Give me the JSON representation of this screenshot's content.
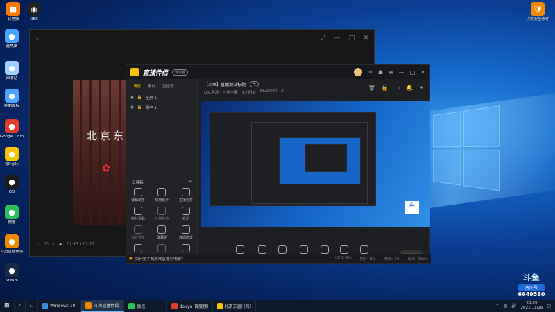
{
  "desktop_icons": [
    {
      "label": "此电脑",
      "icon": "computer-icon",
      "color": "#4aa3ff"
    },
    {
      "label": "回收站",
      "icon": "recycle-bin-icon",
      "color": "#9fd0ff"
    },
    {
      "label": "控制面板",
      "icon": "control-panel-icon",
      "color": "#4aa3ff"
    },
    {
      "label": "Google Chrome",
      "icon": "chrome-icon",
      "color": "#e33b2e"
    },
    {
      "label": "QQ音乐",
      "icon": "qqmusic-icon",
      "color": "#f5c400"
    },
    {
      "label": "QQ",
      "icon": "qq-icon",
      "color": "#1b1b1b"
    },
    {
      "label": "微信",
      "icon": "wechat-icon",
      "color": "#2cc05c"
    },
    {
      "label": "斗鱼直播伴侣",
      "icon": "douyu-icon",
      "color": "#f08a00"
    },
    {
      "label": "Steam",
      "icon": "steam-icon",
      "color": "#1b2a44"
    }
  ],
  "top_icons": [
    {
      "label": "此电脑",
      "color": "#ff7a00"
    },
    {
      "label": "OBS",
      "color": "#222"
    }
  ],
  "top_right_icon": {
    "label": "火绒安全软件",
    "color": "#f08a00"
  },
  "player": {
    "time": "02:13 / 02:17",
    "video_text": "北京东"
  },
  "app": {
    "title": "直播伴侣",
    "version_tag": "测试版",
    "left_tabs": [
      "场景",
      "素材",
      "直播源"
    ],
    "scenes": [
      "全屏 1",
      "画中 1"
    ],
    "tools_title": "工具箱",
    "tools": [
      {
        "label": "弹幕助手",
        "dim": false
      },
      {
        "label": "房管助手",
        "dim": false
      },
      {
        "label": "主播任务",
        "dim": false
      },
      {
        "label": "粉丝道具",
        "dim": false
      },
      {
        "label": "礼物特效",
        "dim": true
      },
      {
        "label": "音乐",
        "dim": false
      },
      {
        "label": "语音连麦",
        "dim": true
      },
      {
        "label": "弹幕姬",
        "dim": false
      },
      {
        "label": "数据统计",
        "dim": false
      },
      {
        "label": "全民PK",
        "dim": false
      },
      {
        "label": "互动游戏",
        "dim": true
      },
      {
        "label": "上传一键",
        "dim": false
      }
    ],
    "notice": "如何把手机游戏直播到电脑?",
    "notice_right": [
      "CPU: 4%",
      "内存: 8%",
      "帧率: 60",
      "码率: 0kb/s"
    ],
    "main_title": "【斗鱼】直播测试标题",
    "main_title_tag": "改",
    "main_sub": [
      "LOL手游 - 斗鱼主播",
      "1小时前",
      "6649580",
      "0"
    ],
    "bottom_tools": [
      "直播录屏",
      "摄像头",
      "多机位",
      "手机投屏",
      "游戏",
      "麦克风",
      "扬声器"
    ],
    "go_live": "开始直播"
  },
  "taskbar": {
    "apps": [
      {
        "label": "Windows 10 ...",
        "color": "#3a8de0",
        "active": false
      },
      {
        "label": "斗鱼直播伴侣",
        "color": "#f08a00",
        "active": true
      },
      {
        "label": "微信",
        "color": "#2cc05c",
        "active": false
      },
      {
        "label": "douyu_百度搜索",
        "color": "#e33b2e",
        "active": false
      },
      {
        "label": "北京东直门的日子",
        "color": "#f5c400",
        "active": false
      }
    ],
    "time": "20:09",
    "date": "2021/11/26"
  },
  "watermark": {
    "logo": "斗鱼",
    "room_label": "房间号",
    "room_number": "6649580"
  }
}
